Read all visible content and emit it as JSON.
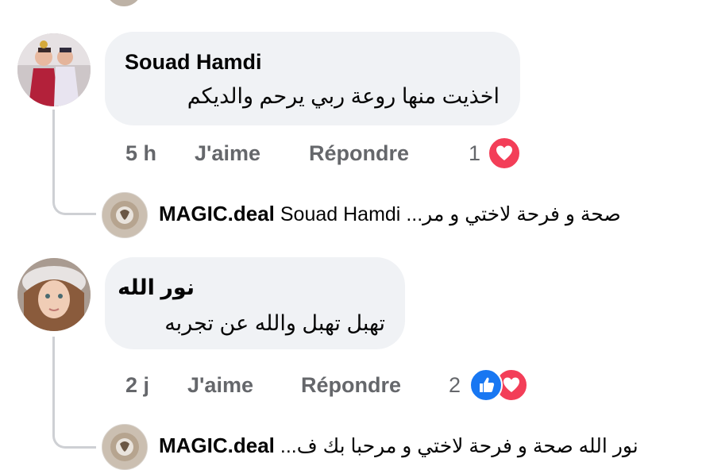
{
  "comments": [
    {
      "author": "Souad Hamdi",
      "text": "اخذيت منها روعة ربي يرحم والديكم",
      "time": "5 h",
      "like_label": "J'aime",
      "reply_label": "Répondre",
      "reaction_count": "1",
      "reactions": [
        "love-icon"
      ],
      "reply": {
        "author": "MAGIC.deal",
        "mention": "Souad Hamdi",
        "text": "صحة و فرحة لاختي و مر..."
      }
    },
    {
      "author": "نور الله",
      "text": "تهبل تهبل والله عن تجربه",
      "time": "2 j",
      "like_label": "J'aime",
      "reply_label": "Répondre",
      "reaction_count": "2",
      "reactions": [
        "like-icon",
        "love-icon"
      ],
      "reply": {
        "author": "MAGIC.deal",
        "text": "نور الله صحة و فرحة لاختي و مرحبا بك ف..."
      }
    }
  ],
  "colors": {
    "bubble": "#f0f2f5",
    "meta_text": "#65676b",
    "like_blue": "#1877f2",
    "love_red": "#f33e58",
    "thread_line": "#ced0d4"
  }
}
